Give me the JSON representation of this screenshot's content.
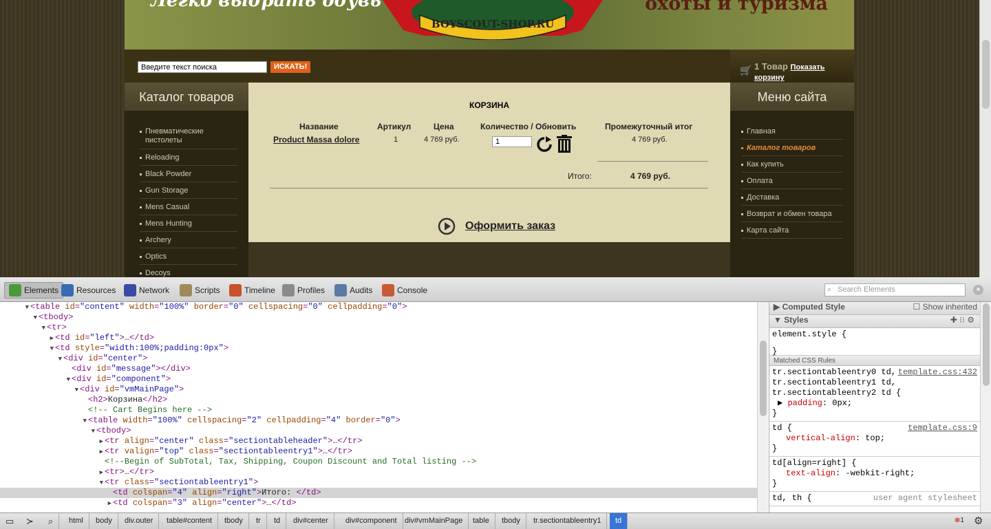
{
  "banner": {
    "slogan": "Легко выбрать обувь",
    "logo_text": "BOYSCOUT-SHOP.RU",
    "right_text": "охоты и туризма"
  },
  "search": {
    "placeholder": "Введите текст поиска",
    "button": "ИСКАТЬ!"
  },
  "mini_cart": {
    "count": "1 Товар",
    "link": "Показать корзину"
  },
  "left_menu": {
    "title": "Каталог товаров",
    "items": [
      "Пневматические пистолеты",
      "Reloading",
      "Black Powder",
      "Gun Storage",
      "Mens Casual",
      "Mens Hunting",
      "Archery",
      "Optics",
      "Decoys"
    ]
  },
  "right_menu": {
    "title": "Меню сайта",
    "items": [
      "Главная",
      "Каталог товаров",
      "Как купить",
      "Оплата",
      "Доставка",
      "Возврат и обмен товара",
      "Карта сайта"
    ],
    "active": "Каталог товаров"
  },
  "cart": {
    "title": "КОРЗИНА",
    "headers": {
      "name": "Название",
      "sku": "Артикул",
      "price": "Цена",
      "qty": "Количество / Обновить",
      "subtotal": "Промежуточный итог"
    },
    "row": {
      "name": "Product Massa dolore",
      "sku": "1",
      "price": "4 769 руб.",
      "qty": "1",
      "subtotal": "4 769 руб."
    },
    "total_label": "Итого:",
    "total_value": "4 769 руб.",
    "checkout": "Оформить заказ"
  },
  "devtools": {
    "tabs": [
      {
        "label": "Elements",
        "color": "#4a9a3a"
      },
      {
        "label": "Resources",
        "color": "#3a6ab5"
      },
      {
        "label": "Network",
        "color": "#3a4aa5"
      },
      {
        "label": "Scripts",
        "color": "#a08a5a"
      },
      {
        "label": "Timeline",
        "color": "#c8502a"
      },
      {
        "label": "Profiles",
        "color": "#8a8a8a"
      },
      {
        "label": "Audits",
        "color": "#5a7aa5"
      },
      {
        "label": "Console",
        "color": "#c85a3a"
      }
    ],
    "search_placeholder": "Search Elements",
    "dom": [
      {
        "i": 0,
        "a": "▼",
        "h": [
          [
            "t",
            "<table "
          ],
          [
            "n",
            "id"
          ],
          [
            "t",
            "="
          ],
          [
            "v",
            "\"content\""
          ],
          [
            "t",
            " "
          ],
          [
            "n",
            "width"
          ],
          [
            "t",
            "="
          ],
          [
            "v",
            "\"100%\""
          ],
          [
            "t",
            " "
          ],
          [
            "n",
            "border"
          ],
          [
            "t",
            "="
          ],
          [
            "v",
            "\"0\""
          ],
          [
            "t",
            " "
          ],
          [
            "n",
            "cellspacing"
          ],
          [
            "t",
            "="
          ],
          [
            "v",
            "\"0\""
          ],
          [
            "t",
            " "
          ],
          [
            "n",
            "cellpadding"
          ],
          [
            "t",
            "="
          ],
          [
            "v",
            "\"0\""
          ],
          [
            "t",
            ">"
          ]
        ]
      },
      {
        "i": 1,
        "a": "▼",
        "h": [
          [
            "t",
            "<tbody>"
          ]
        ]
      },
      {
        "i": 2,
        "a": "▼",
        "h": [
          [
            "t",
            "<tr>"
          ]
        ]
      },
      {
        "i": 3,
        "a": "▶",
        "h": [
          [
            "t",
            "<td "
          ],
          [
            "n",
            "id"
          ],
          [
            "t",
            "="
          ],
          [
            "v",
            "\"left\""
          ],
          [
            "t",
            ">"
          ],
          [
            "x",
            "…"
          ],
          [
            "t",
            "</td>"
          ]
        ]
      },
      {
        "i": 3,
        "a": "▼",
        "h": [
          [
            "t",
            "<td "
          ],
          [
            "n",
            "style"
          ],
          [
            "t",
            "="
          ],
          [
            "v",
            "\"width:100%;padding:0px\""
          ],
          [
            "t",
            ">"
          ]
        ]
      },
      {
        "i": 4,
        "a": "▼",
        "h": [
          [
            "t",
            "<div "
          ],
          [
            "n",
            "id"
          ],
          [
            "t",
            "="
          ],
          [
            "v",
            "\"center\""
          ],
          [
            "t",
            ">"
          ]
        ]
      },
      {
        "i": 5,
        "a": "",
        "h": [
          [
            "t",
            "<div "
          ],
          [
            "n",
            "id"
          ],
          [
            "t",
            "="
          ],
          [
            "v",
            "\"message\""
          ],
          [
            "t",
            "></div>"
          ]
        ]
      },
      {
        "i": 5,
        "a": "▼",
        "h": [
          [
            "t",
            "<div "
          ],
          [
            "n",
            "id"
          ],
          [
            "t",
            "="
          ],
          [
            "v",
            "\"component\""
          ],
          [
            "t",
            ">"
          ]
        ]
      },
      {
        "i": 6,
        "a": "▼",
        "h": [
          [
            "t",
            "<div "
          ],
          [
            "n",
            "id"
          ],
          [
            "t",
            "="
          ],
          [
            "v",
            "\"vmMainPage\""
          ],
          [
            "t",
            ">"
          ]
        ]
      },
      {
        "i": 7,
        "a": "",
        "h": [
          [
            "t",
            "<h2>"
          ],
          [
            "x",
            "Корзина"
          ],
          [
            "t",
            "</h2>"
          ]
        ]
      },
      {
        "i": 7,
        "a": "",
        "h": [
          [
            "c",
            "<!-- Cart Begins here -->"
          ]
        ]
      },
      {
        "i": 7,
        "a": "▼",
        "h": [
          [
            "t",
            "<table "
          ],
          [
            "n",
            "width"
          ],
          [
            "t",
            "="
          ],
          [
            "v",
            "\"100%\""
          ],
          [
            "t",
            " "
          ],
          [
            "n",
            "cellspacing"
          ],
          [
            "t",
            "="
          ],
          [
            "v",
            "\"2\""
          ],
          [
            "t",
            " "
          ],
          [
            "n",
            "cellpadding"
          ],
          [
            "t",
            "="
          ],
          [
            "v",
            "\"4\""
          ],
          [
            "t",
            " "
          ],
          [
            "n",
            "border"
          ],
          [
            "t",
            "="
          ],
          [
            "v",
            "\"0\""
          ],
          [
            "t",
            ">"
          ]
        ]
      },
      {
        "i": 8,
        "a": "▼",
        "h": [
          [
            "t",
            "<tbody>"
          ]
        ]
      },
      {
        "i": 9,
        "a": "▶",
        "h": [
          [
            "t",
            "<tr "
          ],
          [
            "n",
            "align"
          ],
          [
            "t",
            "="
          ],
          [
            "v",
            "\"center\""
          ],
          [
            "t",
            " "
          ],
          [
            "n",
            "class"
          ],
          [
            "t",
            "="
          ],
          [
            "v",
            "\"sectiontableheader\""
          ],
          [
            "t",
            ">"
          ],
          [
            "x",
            "…"
          ],
          [
            "t",
            "</tr>"
          ]
        ]
      },
      {
        "i": 9,
        "a": "▶",
        "h": [
          [
            "t",
            "<tr "
          ],
          [
            "n",
            "valign"
          ],
          [
            "t",
            "="
          ],
          [
            "v",
            "\"top\""
          ],
          [
            "t",
            " "
          ],
          [
            "n",
            "class"
          ],
          [
            "t",
            "="
          ],
          [
            "v",
            "\"sectiontableentry1\""
          ],
          [
            "t",
            ">"
          ],
          [
            "x",
            "…"
          ],
          [
            "t",
            "</tr>"
          ]
        ]
      },
      {
        "i": 9,
        "a": "",
        "h": [
          [
            "c",
            "<!--Begin of SubTotal, Tax, Shipping, Coupon Discount and Total listing -->"
          ]
        ]
      },
      {
        "i": 9,
        "a": "▶",
        "h": [
          [
            "t",
            "<tr>"
          ],
          [
            "x",
            "…"
          ],
          [
            "t",
            "</tr>"
          ]
        ]
      },
      {
        "i": 9,
        "a": "▼",
        "h": [
          [
            "t",
            "<tr "
          ],
          [
            "n",
            "class"
          ],
          [
            "t",
            "="
          ],
          [
            "v",
            "\"sectiontableentry1\""
          ],
          [
            "t",
            ">"
          ]
        ]
      },
      {
        "i": 10,
        "a": "",
        "hl": true,
        "h": [
          [
            "t",
            "<td "
          ],
          [
            "n",
            "colspan"
          ],
          [
            "t",
            "="
          ],
          [
            "v",
            "\"4\""
          ],
          [
            "t",
            " "
          ],
          [
            "n",
            "align"
          ],
          [
            "t",
            "="
          ],
          [
            "v",
            "\"right\""
          ],
          [
            "t",
            ">"
          ],
          [
            "x",
            "Итого: "
          ],
          [
            "t",
            "</td>"
          ]
        ]
      },
      {
        "i": 10,
        "a": "▶",
        "h": [
          [
            "t",
            "<td "
          ],
          [
            "n",
            "colspan"
          ],
          [
            "t",
            "="
          ],
          [
            "v",
            "\"3\""
          ],
          [
            "t",
            " "
          ],
          [
            "n",
            "align"
          ],
          [
            "t",
            "="
          ],
          [
            "v",
            "\"center\""
          ],
          [
            "t",
            ">"
          ],
          [
            "x",
            "…"
          ],
          [
            "t",
            "</td>"
          ]
        ]
      }
    ],
    "sidebar": {
      "computed": "Computed Style",
      "show_inherited": "Show inherited",
      "styles": "Styles",
      "element_style": "element.style {",
      "close_brace": "}",
      "matched": "Matched CSS Rules",
      "rule1": {
        "selectors": [
          "tr.sectiontableentry0 td,",
          "tr.sectiontableentry1 td,",
          "tr.sectiontableentry2 td {"
        ],
        "source": "template.css:432",
        "prop": "padding",
        "val": "0px;"
      },
      "rule2": {
        "selectors": [
          "td {"
        ],
        "source": "template.css:9",
        "prop": "vertical-align",
        "val": "top;"
      },
      "rule3": {
        "selectors": [
          "td[align=right] {"
        ],
        "source": "",
        "prop": "text-align",
        "val": "-webkit-right;"
      },
      "rule4": {
        "selectors": [
          "td, th {"
        ],
        "source": "user agent stylesheet"
      }
    },
    "breadcrumbs": [
      "html",
      "body",
      "div.outer",
      "table#content",
      "tbody",
      "tr",
      "td",
      "div#center",
      "div#component",
      "div#vmMainPage",
      "table",
      "tbody",
      "tr.sectiontableentry1",
      "td"
    ],
    "error_count": "1"
  }
}
